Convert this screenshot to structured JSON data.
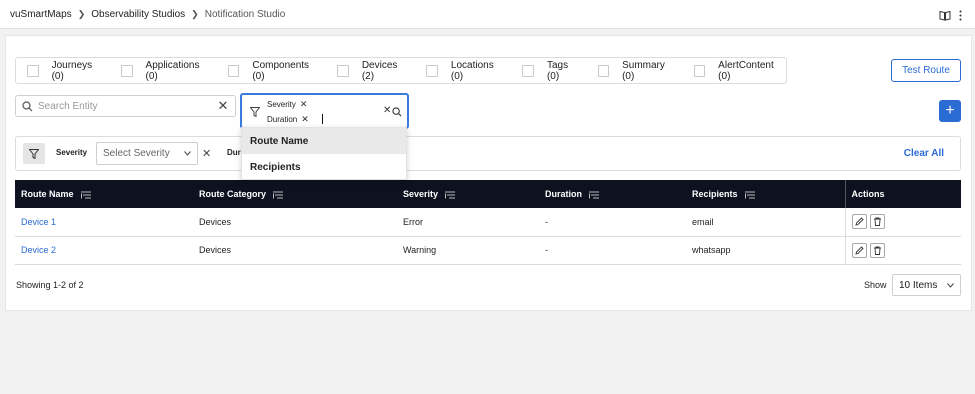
{
  "breadcrumb": [
    "vuSmartMaps",
    "Observability Studios",
    "Notification Studio"
  ],
  "entities": [
    {
      "label": "Journeys (0)"
    },
    {
      "label": "Applications (0)"
    },
    {
      "label": "Components (0)"
    },
    {
      "label": "Devices (2)"
    },
    {
      "label": "Locations (0)"
    },
    {
      "label": "Tags (0)"
    },
    {
      "label": "Summary (0)"
    },
    {
      "label": "AlertContent (0)"
    }
  ],
  "test_route_label": "Test Route",
  "search": {
    "placeholder": "Search Entity"
  },
  "filter_input": {
    "chips": [
      "Severity",
      "Duration"
    ]
  },
  "dropdown": {
    "items": [
      "Route Name",
      "Recipients"
    ]
  },
  "filters": {
    "severity_label": "Severity",
    "severity_placeholder": "Select Severity",
    "duration_label": "Dura",
    "clear_all": "Clear All"
  },
  "table": {
    "columns": [
      "Route Name",
      "Route Category",
      "Severity",
      "Duration",
      "Recipients",
      "Actions"
    ],
    "rows": [
      {
        "route_name": "Device 1",
        "category": "Devices",
        "severity": "Error",
        "duration": "-",
        "recipients": "email"
      },
      {
        "route_name": "Device 2",
        "category": "Devices",
        "severity": "Warning",
        "duration": "-",
        "recipients": "whatsapp"
      }
    ]
  },
  "footer": {
    "showing": "Showing 1-2 of 2",
    "show_label": "Show",
    "items_per_page": "10 Items"
  },
  "colors": {
    "accent": "#2b6cd4",
    "table_header": "#0e1220"
  }
}
